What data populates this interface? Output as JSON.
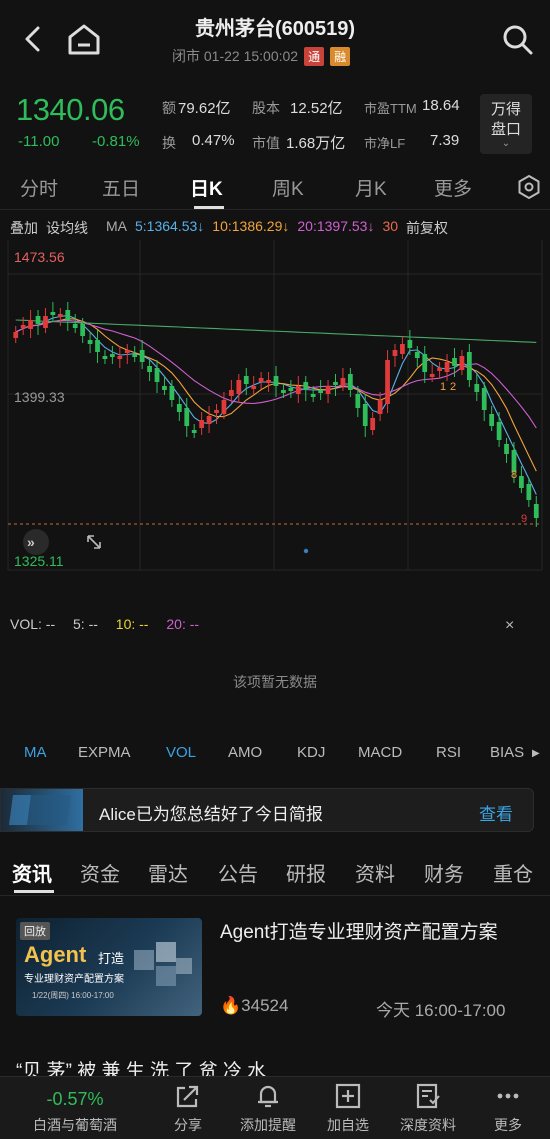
{
  "header": {
    "title": "贵州茅台(600519)",
    "status": "闭市 01-22 15:00:02",
    "tag_tong": "通",
    "tag_rong": "融"
  },
  "quote": {
    "price": "1340.06",
    "change": "-11.00",
    "change_pct": "-0.81%",
    "turnover_label": "额",
    "turnover_value": "79.62亿",
    "shares_label": "股本",
    "shares_value": "12.52亿",
    "pe_label": "市盈TTM",
    "pe_value": "18.64",
    "rate_label": "换",
    "rate_value": "0.47%",
    "mcap_label": "市值",
    "mcap_value": "1.68万亿",
    "pb_label": "市净LF",
    "pb_value": "7.39",
    "wind_button": "万得盘口"
  },
  "period_tabs": [
    {
      "label": "分时"
    },
    {
      "label": "五日"
    },
    {
      "label": "日K"
    },
    {
      "label": "周K"
    },
    {
      "label": "月K"
    },
    {
      "label": "更多"
    }
  ],
  "ma_row": {
    "overlay": "叠加",
    "set_ma": "设均线",
    "ma": "MA",
    "ma5": "5:1364.53↓",
    "ma10": "10:1386.29↓",
    "ma20": "20:1397.53↓",
    "ma30": "30",
    "adjust": "前复权",
    "colors": {
      "ma5": "#5ab0e8",
      "ma10": "#f0a33c",
      "ma20": "#d060d0",
      "ma30": "#e66a4e"
    }
  },
  "chart_data": {
    "type": "candlestick",
    "high_label": "1473.56",
    "mid_label": "1399.33",
    "low_label": "1325.11",
    "ylim": [
      1325.11,
      1473.56
    ],
    "markers": [
      "1",
      "2",
      "8",
      "9"
    ],
    "colors": {
      "up": "#e03a3a",
      "down": "#2ebd5a"
    }
  },
  "volume": {
    "label": "VOL: --",
    "v5": "5: --",
    "v10": "10: --",
    "v20": "20: --",
    "close": "×",
    "empty_text": "该项暂无数据"
  },
  "indicator_tabs": [
    {
      "label": "MA"
    },
    {
      "label": "EXPMA"
    },
    {
      "label": "VOL"
    },
    {
      "label": "AMO"
    },
    {
      "label": "KDJ"
    },
    {
      "label": "MACD"
    },
    {
      "label": "RSI"
    },
    {
      "label": "BIAS"
    }
  ],
  "alice": {
    "text": "Alice已为您总结好了今日简报",
    "button": "查看"
  },
  "news_tabs": [
    {
      "label": "资讯"
    },
    {
      "label": "资金"
    },
    {
      "label": "雷达"
    },
    {
      "label": "公告"
    },
    {
      "label": "研报"
    },
    {
      "label": "资料"
    },
    {
      "label": "财务"
    },
    {
      "label": "重仓"
    }
  ],
  "news": {
    "thumb_tag": "回放",
    "thumb_title": "Agent",
    "thumb_title2": "打造",
    "thumb_sub": "专业理财资产配置方案",
    "thumb_time": "1/22(周四) 16:00-17:00",
    "title": "Agent打造专业理财资产配置方案",
    "views": "34524",
    "time": "今天  16:00-17:00",
    "next_title": "“贝 茅” 被 兼 生 洗 了 贫 冷 水"
  },
  "bottom_bar": {
    "sector_change": "-0.57%",
    "sector_name": "白酒与葡萄酒",
    "share": "分享",
    "alert": "添加提醒",
    "add": "加自选",
    "deep": "深度资料",
    "more": "更多"
  }
}
